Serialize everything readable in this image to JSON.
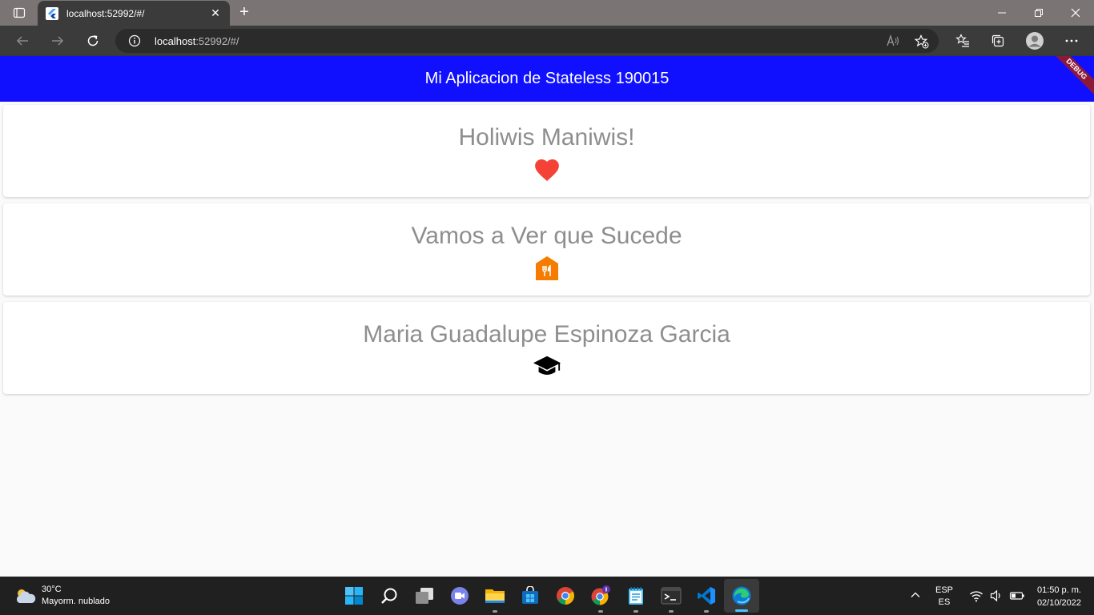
{
  "browser": {
    "tab_title": "localhost:52992/#/",
    "tab_close": "✕",
    "new_tab": "+",
    "url_host": "localhost",
    "url_rest": ":52992/#/"
  },
  "app": {
    "title": "Mi Aplicacion de Stateless 190015",
    "debug_label": "DEBUG",
    "colors": {
      "appbar": "#1010ff",
      "heart": "#f44336",
      "restaurant": "#f57c00",
      "school": "#000000"
    },
    "cards": [
      {
        "title": "Holiwis Maniwis!",
        "icon": "heart-icon"
      },
      {
        "title": "Vamos a Ver que Sucede",
        "icon": "restaurant-icon"
      },
      {
        "title": "Maria Guadalupe Espinoza Garcia",
        "icon": "school-icon"
      }
    ]
  },
  "taskbar": {
    "weather_temp": "30°C",
    "weather_desc": "Mayorm. nublado",
    "lang_top": "ESP",
    "lang_bottom": "ES",
    "time": "01:50 p. m.",
    "date": "02/10/2022",
    "apps": [
      "start-icon",
      "search-icon",
      "task-view-icon",
      "teams-icon",
      "file-explorer-icon",
      "store-icon",
      "chrome-icon",
      "chrome-profile-icon",
      "notepad-icon",
      "terminal-icon",
      "vscode-icon",
      "edge-icon"
    ]
  }
}
